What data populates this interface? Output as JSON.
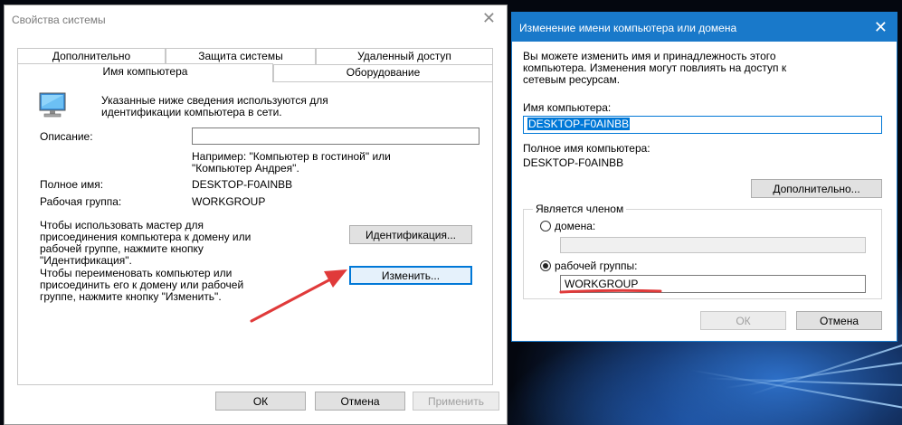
{
  "system_props": {
    "title": "Свойства системы",
    "close_glyph": "✕",
    "tabs_row1": [
      "Дополнительно",
      "Защита системы",
      "Удаленный доступ"
    ],
    "tabs_row2": [
      "Имя компьютера",
      "Оборудование"
    ],
    "intro_text": "Указанные ниже сведения используются для\nидентификации компьютера в сети.",
    "description_label": "Описание:",
    "description_value": "",
    "example_text": "Например: \"Компьютер в гостиной\" или\n\"Компьютер Андрея\".",
    "full_name_label": "Полное имя:",
    "full_name_value": "DESKTOP-F0AINBB",
    "workgroup_label": "Рабочая группа:",
    "workgroup_value": "WORKGROUP",
    "wizard_text": "Чтобы использовать мастер для\nприсоединения компьютера к домену или\nрабочей группе, нажмите кнопку\n\"Идентификация\".",
    "id_button": "Идентификация...",
    "rename_text": "Чтобы переименовать компьютер или\nприсоединить его к домену или рабочей\nгруппе, нажмите кнопку \"Изменить\".",
    "change_button": "Изменить...",
    "ok_button": "ОК",
    "cancel_button": "Отмена",
    "apply_button": "Применить"
  },
  "rename_dialog": {
    "title": "Изменение имени компьютера или домена",
    "close_glyph": "✕",
    "info_text": "Вы можете изменить имя и принадлежность этого\nкомпьютера. Изменения могут повлиять на доступ к\nсетевым ресурсам.",
    "computer_name_label": "Имя компьютера:",
    "computer_name_value": "DESKTOP-F0AINBB",
    "full_name_label": "Полное имя компьютера:",
    "full_name_value": "DESKTOP-F0AINBB",
    "more_button": "Дополнительно...",
    "member_group_label": "Является членом",
    "domain_label": "домена:",
    "domain_value": "",
    "workgroup_label": "рабочей группы:",
    "workgroup_value": "WORKGROUP",
    "ok_button": "ОК",
    "cancel_button": "Отмена"
  },
  "colors": {
    "accent": "#0078d7",
    "title_bar": "#1979ca",
    "annotation_red": "#e03a3a"
  }
}
